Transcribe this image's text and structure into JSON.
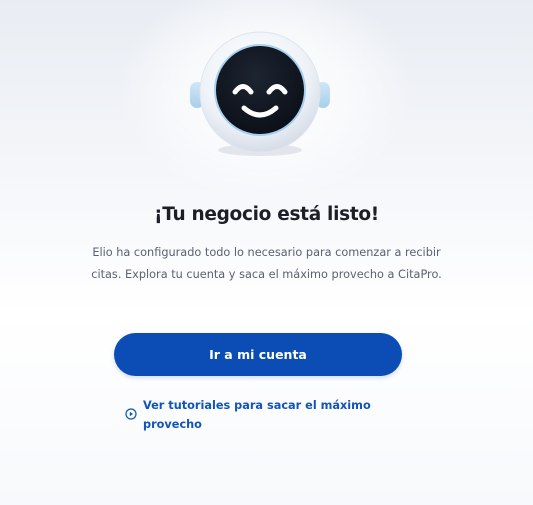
{
  "onboarding": {
    "avatar_icon": "smiling-robot-icon",
    "title": "¡Tu negocio está listo!",
    "description": "Elio ha configurado todo lo necesario para comenzar a recibir citas. Explora tu cuenta y saca el máximo provecho a CitaPro.",
    "primary_button_label": "Ir a mi cuenta",
    "tutorial_link_icon": "play-circle-icon",
    "tutorial_link_label": "Ver tutoriales para sacar el máximo provecho"
  },
  "colors": {
    "primary": "#0b4db4",
    "link": "#1155b8",
    "title": "#1c1f26",
    "body_text": "#5b6170",
    "robot_face": "#0f1520",
    "robot_ring": "#5aa8e8"
  }
}
